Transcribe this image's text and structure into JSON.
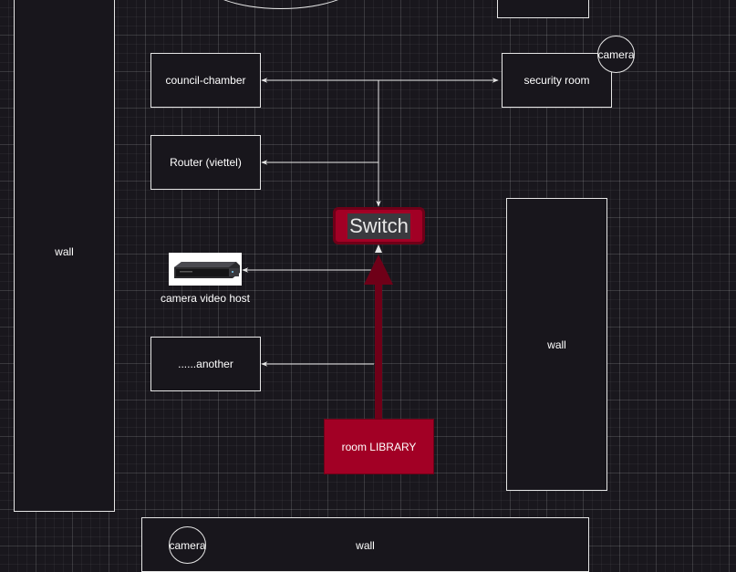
{
  "nodes": {
    "wall_left": "wall",
    "wall_right": "wall",
    "wall_bottom": "wall",
    "council_chamber": "council-chamber",
    "router": "Router (viettel)",
    "security_room": "security room",
    "camera_security": "camera",
    "camera_bottom": "camera",
    "switch": "Switch",
    "camera_video_host": "camera video host",
    "another": "......another",
    "room_library": "room LIBRARY"
  },
  "colors": {
    "background": "#19171d",
    "accent_red": "#a20025",
    "accent_dark_red": "#6f0018",
    "line": "#e6e6e6"
  },
  "icons": {
    "video_recorder": "nvr-device-icon"
  }
}
